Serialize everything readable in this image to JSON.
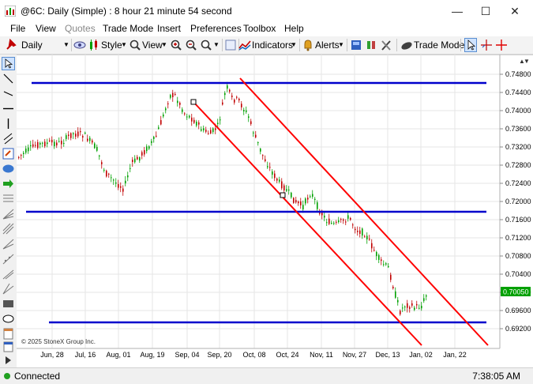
{
  "window": {
    "title": "@6C: Daily (Simple) : 8 hour 21 minute 54 second",
    "minimize": "—",
    "maximize": "☐",
    "close": "✕"
  },
  "menu": {
    "items": [
      {
        "label": "File",
        "enabled": true
      },
      {
        "label": "View",
        "enabled": true
      },
      {
        "label": "Quotes",
        "enabled": false
      },
      {
        "label": "Trade Mode",
        "enabled": true
      },
      {
        "label": "Insert",
        "enabled": true
      },
      {
        "label": "Preferences",
        "enabled": true
      },
      {
        "label": "Toolbox",
        "enabled": true
      },
      {
        "label": "Help",
        "enabled": true
      }
    ]
  },
  "toolbar": {
    "interval": "Daily",
    "style": "Style",
    "view": "View",
    "indicators": "Indicators",
    "alerts": "Alerts",
    "trade_mode": "Trade Mode"
  },
  "chart": {
    "copyright": "© 2025 StoneX Group Inc.",
    "last_price": "0.70050",
    "price_labels": [
      "0.74800",
      "0.74400",
      "0.74000",
      "0.73600",
      "0.73200",
      "0.72800",
      "0.72400",
      "0.72000",
      "0.71600",
      "0.71200",
      "0.70800",
      "0.70400",
      "0.70000",
      "0.69600",
      "0.69200"
    ],
    "date_labels": [
      "Jun, 28",
      "Jul, 16",
      "Aug, 01",
      "Aug, 19",
      "Sep, 04",
      "Sep, 20",
      "Oct, 08",
      "Oct, 24",
      "Nov, 11",
      "Nov, 27",
      "Dec, 13",
      "Jan, 02",
      "Jan, 22"
    ],
    "colors": {
      "up": "#00a000",
      "down": "#c00000",
      "hline": "#0000cc",
      "channel": "#ff0000",
      "last_price_bg": "#00a000"
    }
  },
  "status": {
    "connection": "Connected",
    "time": "7:38:05 AM"
  }
}
